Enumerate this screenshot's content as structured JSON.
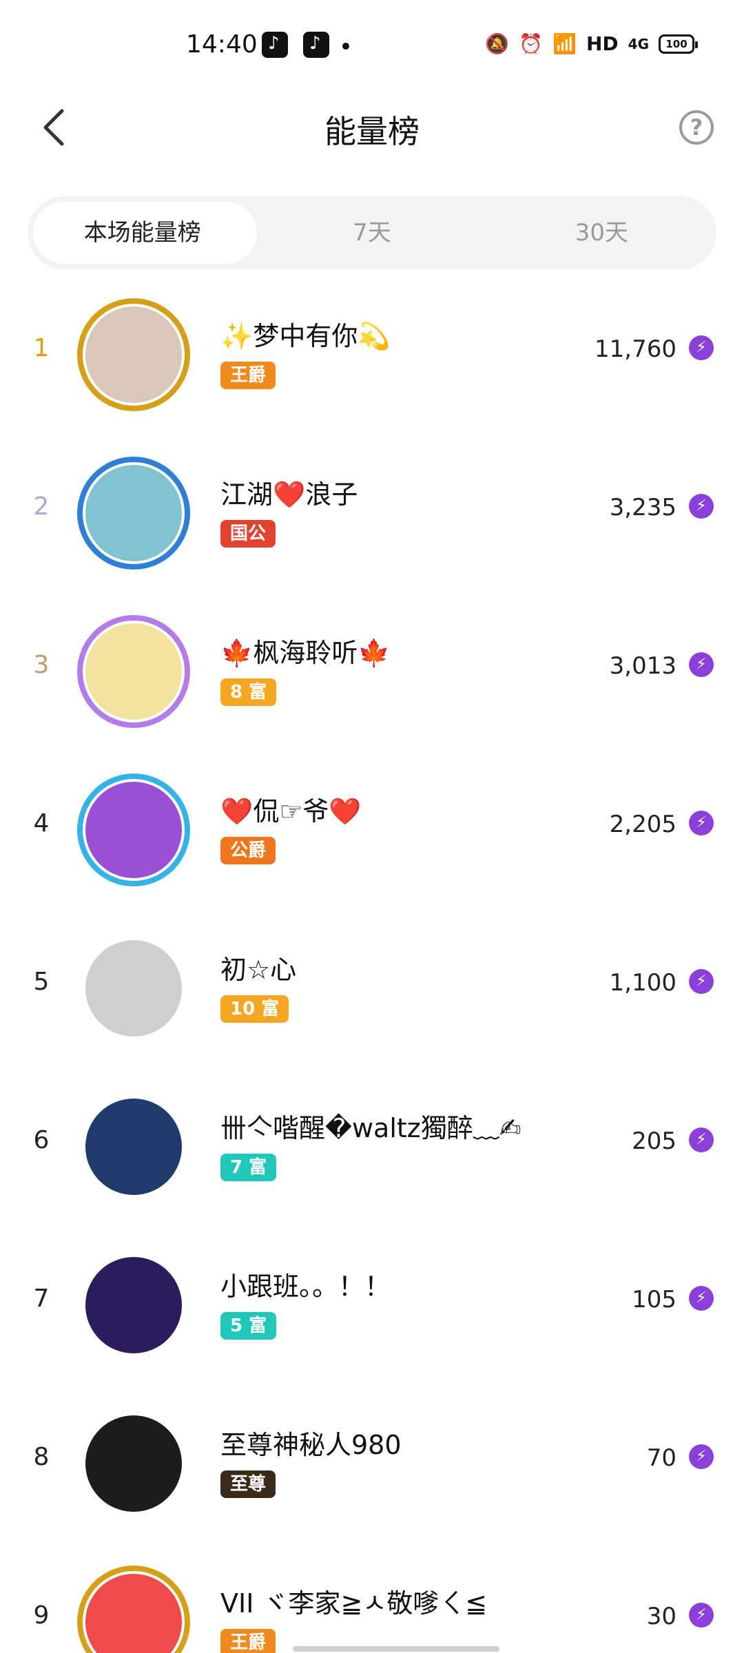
{
  "status_bar": {
    "time": "14:40",
    "icons": [
      "tiktok-icon",
      "tiktok-icon",
      "dot",
      "mute-icon",
      "alarm-icon",
      "wifi-icon",
      "hd",
      "signal-4g-icon",
      "battery-icon"
    ],
    "hd_label": "HD",
    "signal_label": "4G",
    "battery_level": "100"
  },
  "header": {
    "title": "能量榜",
    "back_icon": "chevron-left-icon",
    "help_icon": "question-circle-icon",
    "help_glyph": "?"
  },
  "tabs": [
    {
      "label": "本场能量榜",
      "active": true
    },
    {
      "label": "7天",
      "active": false
    },
    {
      "label": "30天",
      "active": false
    }
  ],
  "colors": {
    "rank1": "#e0a100",
    "rank2": "#a9a9d6",
    "rank3": "#c29a6b",
    "energy_icon": "#8b3fd9",
    "tab_bg": "#f3f3f3"
  },
  "leaderboard": [
    {
      "rank": "1",
      "name": "✨梦中有你💫",
      "badge": "王爵",
      "badge_color": "#f08a1c",
      "score": "11,760",
      "avatar_color": "#d9c7b8",
      "frame_color": "#d4a017"
    },
    {
      "rank": "2",
      "name": "江湖❤️浪子",
      "badge": "国公",
      "badge_color": "#e0442f",
      "score": "3,235",
      "avatar_color": "#7fc4cf",
      "frame_color": "#2f7fd6"
    },
    {
      "rank": "3",
      "name": "🍁枫海聆听🍁",
      "badge": "8 富",
      "badge_color": "#f5a623",
      "score": "3,013",
      "avatar_color": "#f3e2a0",
      "frame_color": "#b27de8"
    },
    {
      "rank": "4",
      "name": "❤️侃☞爷❤️",
      "badge": "公爵",
      "badge_color": "#f0761c",
      "score": "2,205",
      "avatar_color": "#9b4fd6",
      "frame_color": "#35b3e6"
    },
    {
      "rank": "5",
      "name": "初☆心",
      "badge": "10 富",
      "badge_color": "#f5a623",
      "score": "1,100",
      "avatar_color": "#cfcfcf",
      "frame_color": ""
    },
    {
      "rank": "6",
      "name": "卌亽喈醒�waltz獨醉﹏✍",
      "badge": "7 富",
      "badge_color": "#1fc7b8",
      "score": "205",
      "avatar_color": "#203a6b",
      "frame_color": ""
    },
    {
      "rank": "7",
      "name": "小跟班。。！！",
      "badge": "5 富",
      "badge_color": "#1fc7b8",
      "score": "105",
      "avatar_color": "#2b1d5c",
      "frame_color": ""
    },
    {
      "rank": "8",
      "name": "至尊神秘人980",
      "badge": "至尊",
      "badge_color": "#3a2a1a",
      "score": "70",
      "avatar_color": "#1c1c1c",
      "frame_color": ""
    },
    {
      "rank": "9",
      "name": "VII ヾ李家≧ㅅ敬嗲ㄑ≦",
      "badge": "王爵",
      "badge_color": "#f08a1c",
      "score": "30",
      "avatar_color": "#f04a4a",
      "frame_color": "#d4a017"
    }
  ],
  "energy_icon": "lightning-bolt-icon",
  "energy_glyph": "⚡"
}
